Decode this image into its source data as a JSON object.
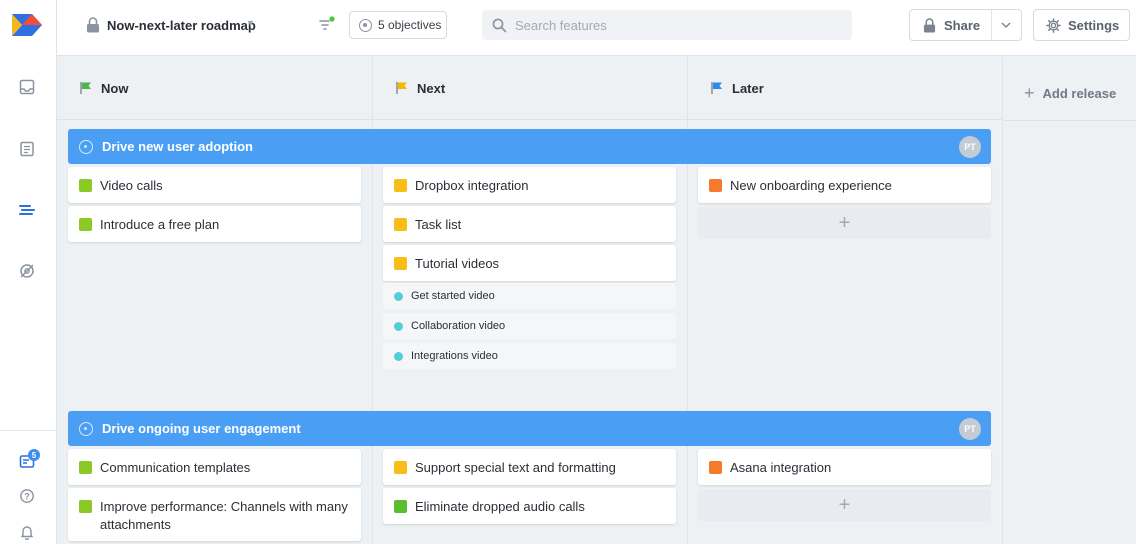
{
  "header": {
    "roadmap_title": "Now-next-later roadmap",
    "objectives_label": "5 objectives",
    "search_placeholder": "Search features",
    "share_label": "Share",
    "settings_label": "Settings"
  },
  "sidebar": {
    "notification_count": "5"
  },
  "columns": [
    {
      "label": "Now",
      "flag_color": "#4cb648"
    },
    {
      "label": "Next",
      "flag_color": "#f5b800"
    },
    {
      "label": "Later",
      "flag_color": "#2f8bf0"
    }
  ],
  "add_release_label": "Add release",
  "objectives": [
    {
      "title": "Drive new user adoption",
      "owner": "PT",
      "now": [
        {
          "label": "Video calls",
          "color": "#8ac926"
        },
        {
          "label": "Introduce a free plan",
          "color": "#8ac926"
        }
      ],
      "next": [
        {
          "label": "Dropbox integration",
          "color": "#f8bd19"
        },
        {
          "label": "Task list",
          "color": "#f8bd19"
        },
        {
          "label": "Tutorial videos",
          "color": "#f8bd19"
        }
      ],
      "next_subfeatures": [
        "Get started video",
        "Collaboration video",
        "Integrations video"
      ],
      "later": [
        {
          "label": "New onboarding experience",
          "color": "#f57a2c"
        }
      ]
    },
    {
      "title": "Drive ongoing user engagement",
      "owner": "PT",
      "now": [
        {
          "label": "Communication templates",
          "color": "#8ac926"
        },
        {
          "label": "Improve performance: Channels with many attachments",
          "color": "#8ac926"
        }
      ],
      "next": [
        {
          "label": "Support special text and formatting",
          "color": "#f8bd19"
        },
        {
          "label": "Eliminate dropped audio calls",
          "color": "#5cbd2e"
        }
      ],
      "later": [
        {
          "label": "Asana integration",
          "color": "#f57a2c"
        }
      ]
    }
  ],
  "colors": {
    "objective_bar": "#4a9ff5",
    "subfeature_dot": "#4fd0d8",
    "badge": "#3b8ef0"
  }
}
